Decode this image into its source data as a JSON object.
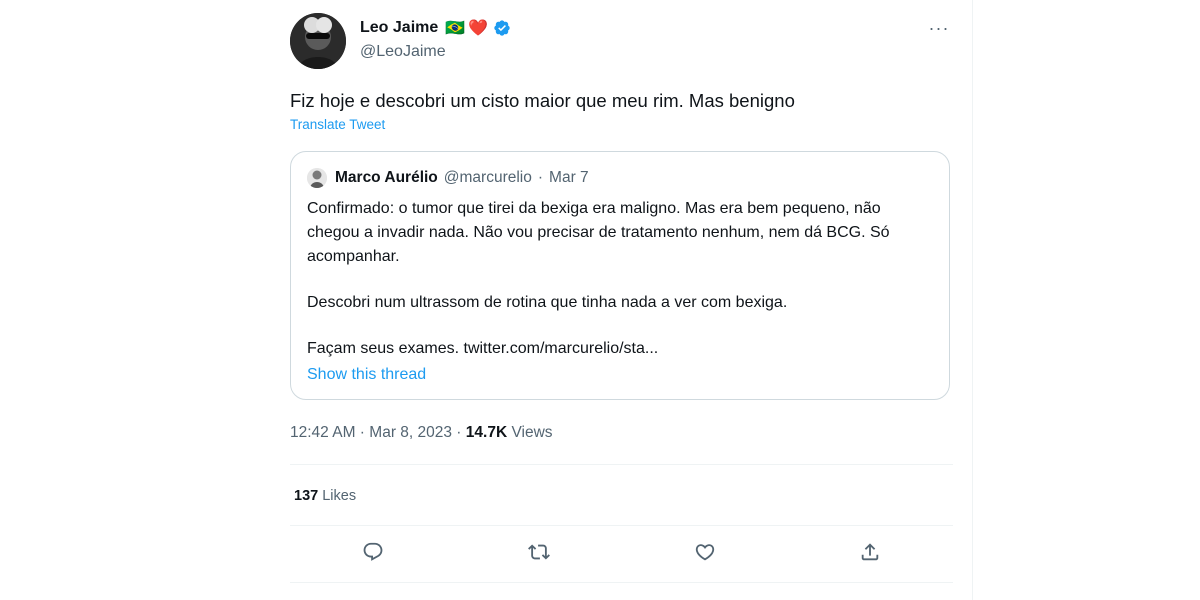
{
  "author": {
    "name": "Leo Jaime",
    "emoji_flag": "🇧🇷",
    "emoji_heart": "❤️",
    "handle": "@LeoJaime",
    "verified": true
  },
  "tweet": {
    "text": "Fiz hoje e descobri um cisto maior que meu rim. Mas benigno",
    "translate_label": "Translate Tweet",
    "time": "12:42 AM",
    "date": "Mar 8, 2023",
    "views_count": "14.7K",
    "views_label": "Views",
    "likes_count": "137",
    "likes_label": "Likes"
  },
  "quote": {
    "name": "Marco Aurélio",
    "handle": "@marcurelio",
    "separator": "·",
    "date": "Mar 7",
    "paragraphs": [
      "Confirmado: o tumor que tirei da bexiga era maligno. Mas era bem pequeno, não chegou a invadir nada. Não vou precisar de tratamento nenhum, nem dá BCG. Só acompanhar.",
      "Descobri num ultrassom de rotina que tinha nada a ver com bexiga.",
      "Façam seus exames. twitter.com/marcurelio/sta..."
    ],
    "show_thread_label": "Show this thread"
  },
  "meta": {
    "separator": " · "
  },
  "icons": {
    "more": "more-horizontal-icon",
    "reply": "reply-icon",
    "retweet": "retweet-icon",
    "like": "heart-icon",
    "share": "share-icon",
    "verified": "verified-badge-icon"
  },
  "colors": {
    "accent": "#1d9bf0",
    "secondary_text": "#536471",
    "border": "#cfd9de"
  }
}
